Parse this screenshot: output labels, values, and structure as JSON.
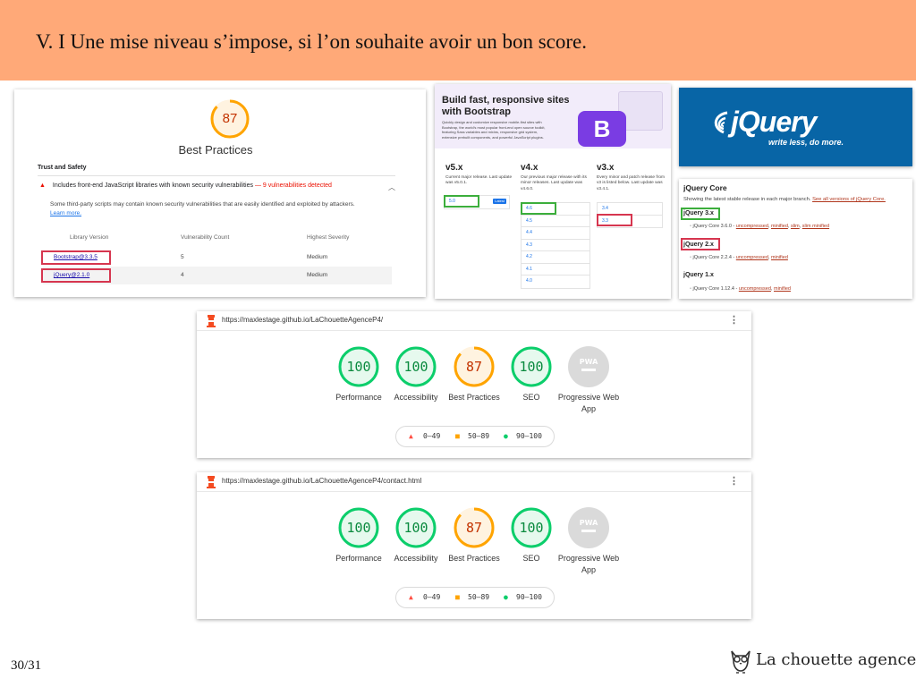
{
  "slide": {
    "title": "V. I Une mise niveau s’impose, si l’on souhaite avoir un bon score.",
    "page_number": "30/31",
    "brand": "La chouette agence",
    "header_color": "#ffa978"
  },
  "best_practices_panel": {
    "score": "87",
    "title": "Best Practices",
    "section": "Trust and Safety",
    "audit": "Includes front-end JavaScript libraries with known security vulnerabilities",
    "audit_separator": "—",
    "audit_warning": "9 vulnerabilities detected",
    "description": "Some third-party scripts may contain known security vulnerabilities that are easily identified and exploited by attackers.",
    "learn_more": "Learn more.",
    "columns": [
      "Library Version",
      "Vulnerability Count",
      "Highest Severity"
    ],
    "rows": [
      {
        "library": "Bootstrap@3.3.5",
        "count": "5",
        "severity": "Medium"
      },
      {
        "library": "jQuery@2.1.0",
        "count": "4",
        "severity": "Medium"
      }
    ]
  },
  "bootstrap_panel": {
    "hero_title": "Build fast, responsive sites with Bootstrap",
    "hero_text": "Quickly design and customize responsive mobile-first sites with Bootstrap, the world’s most popular front-end open source toolkit, featuring Sass variables and mixins, responsive grid system, extensive prebuilt components, and powerful JavaScript plugins.",
    "logo_letter": "B",
    "columns": [
      {
        "heading": "v5.x",
        "text": "Current major release. Last update was v5.0.1.",
        "versions": [
          "5.0"
        ],
        "badge": "Latest"
      },
      {
        "heading": "v4.x",
        "text": "Our previous major release with its minor releases. Last update was v4.6.0.",
        "versions": [
          "4.6",
          "4.5",
          "4.4",
          "4.3",
          "4.2",
          "4.1",
          "4.0"
        ]
      },
      {
        "heading": "v3.x",
        "text": "Every minor and patch release from v3 is listed below. Last update was v3.4.1.",
        "versions": [
          "3.4",
          "3.3"
        ]
      }
    ]
  },
  "jquery_logo": {
    "wordmark": "jQuery",
    "tagline": "write less, do more.",
    "bg_color": "#0865a6"
  },
  "jquery_core": {
    "title": "jQuery Core",
    "description": "Showing the latest stable release in each major branch.",
    "all_versions_link": "See all versions of jQuery Core.",
    "branches": [
      {
        "heading": "jQuery 3.x",
        "item": "jQuery Core 3.6.0 -",
        "links": [
          "uncompressed",
          "minified",
          "slim",
          "slim minified"
        ]
      },
      {
        "heading": "jQuery 2.x",
        "item": "jQuery Core 2.2.4 -",
        "links": [
          "uncompressed",
          "minified"
        ]
      },
      {
        "heading": "jQuery 1.x",
        "item": "jQuery Core 1.12.4 -",
        "links": [
          "uncompressed",
          "minified"
        ]
      }
    ]
  },
  "lighthouse_reports": [
    {
      "url": "https://maxlestage.github.io/LaChouetteAgenceP4/",
      "scores": [
        {
          "value": "100",
          "label": "Performance",
          "level": "pass"
        },
        {
          "value": "100",
          "label": "Accessibility",
          "level": "pass"
        },
        {
          "value": "87",
          "label": "Best Practices",
          "level": "average"
        },
        {
          "value": "100",
          "label": "SEO",
          "level": "pass"
        }
      ],
      "pwa": {
        "label": "Progressive Web App",
        "badge": "PWA"
      }
    },
    {
      "url": "https://maxlestage.github.io/LaChouetteAgenceP4/contact.html",
      "scores": [
        {
          "value": "100",
          "label": "Performance",
          "level": "pass"
        },
        {
          "value": "100",
          "label": "Accessibility",
          "level": "pass"
        },
        {
          "value": "87",
          "label": "Best Practices",
          "level": "average"
        },
        {
          "value": "100",
          "label": "SEO",
          "level": "pass"
        }
      ],
      "pwa": {
        "label": "Progressive Web App",
        "badge": "PWA"
      }
    }
  ],
  "legend": {
    "fail": "0–49",
    "average": "50–89",
    "pass": "90–100"
  },
  "colors": {
    "pass": "#0cce6b",
    "pass_text": "#0a8a3e",
    "average": "#ffa400",
    "average_text": "#c33300",
    "fail": "#ff4e42",
    "highlight_red": "#d6364f",
    "highlight_green": "#3cae3c"
  }
}
